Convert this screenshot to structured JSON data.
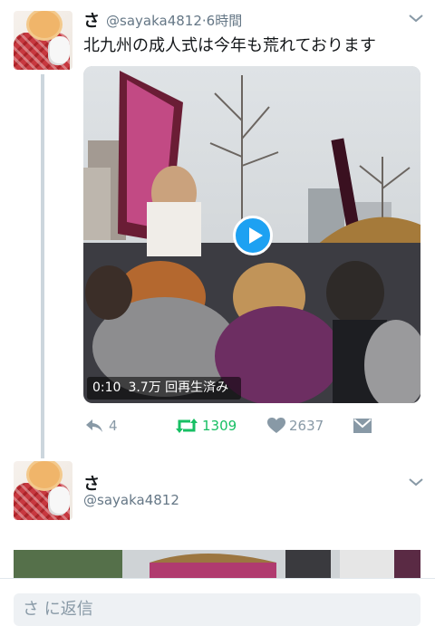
{
  "tweet": {
    "author_name": "さ",
    "author_handle": "@sayaka4812",
    "time_sep": "·",
    "time": "6時間",
    "text": "北九州の成人式は今年も荒れております",
    "video": {
      "duration": "0:10",
      "views": "3.7万 回再生済み"
    },
    "actions": {
      "reply_count": "4",
      "retweet_count": "1309",
      "like_count": "2637"
    }
  },
  "reply": {
    "author_name": "さ",
    "author_handle": "@sayaka4812"
  },
  "composer": {
    "placeholder": "さ に返信"
  },
  "colors": {
    "retweet": "#17bf63",
    "muted": "#8899a6",
    "accent": "#1da1f2"
  }
}
